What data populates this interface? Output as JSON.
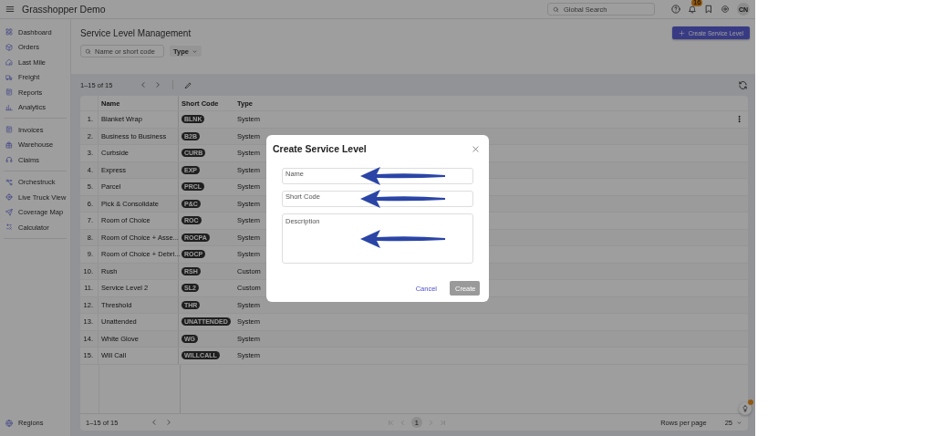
{
  "header": {
    "title": "Grasshopper Demo",
    "search_placeholder": "Global Search",
    "notification_count": "16",
    "avatar": "CN"
  },
  "sidebar": {
    "groups": [
      [
        {
          "label": "Dashboard",
          "selected": false
        },
        {
          "label": "Orders",
          "selected": false
        },
        {
          "label": "Last Mile",
          "selected": false
        },
        {
          "label": "Freight",
          "selected": false
        },
        {
          "label": "Reports",
          "selected": false
        },
        {
          "label": "Analytics",
          "selected": false
        }
      ],
      [
        {
          "label": "Invoices",
          "selected": false
        },
        {
          "label": "Warehouse",
          "selected": false
        },
        {
          "label": "Claims",
          "selected": false
        }
      ],
      [
        {
          "label": "Orchestruck",
          "selected": false
        },
        {
          "label": "Live Truck View",
          "selected": false
        },
        {
          "label": "Coverage Map",
          "selected": false
        },
        {
          "label": "Calculator",
          "selected": false
        }
      ]
    ],
    "bottom_item": {
      "label": "Regions",
      "selected": false
    }
  },
  "page": {
    "title": "Service Level Management",
    "search_placeholder": "Name or short code",
    "filter": "Type",
    "create_button": "Create Service Level",
    "range": "1–15 of 15"
  },
  "table": {
    "columns": [
      "Name",
      "Short Code",
      "Type"
    ],
    "rows": [
      {
        "index": "1.",
        "name": "Blanket Wrap",
        "code": "BLNK",
        "type": "System"
      },
      {
        "index": "2.",
        "name": "Business to Business",
        "code": "B2B",
        "type": "System"
      },
      {
        "index": "3.",
        "name": "Curbside",
        "code": "CURB",
        "type": "System"
      },
      {
        "index": "4.",
        "name": "Express",
        "code": "EXP",
        "type": "System"
      },
      {
        "index": "5.",
        "name": "Parcel",
        "code": "PRCL",
        "type": "System"
      },
      {
        "index": "6.",
        "name": "Pick & Consolidate",
        "code": "P&C",
        "type": "System"
      },
      {
        "index": "7.",
        "name": "Room of Choice",
        "code": "ROC",
        "type": "System"
      },
      {
        "index": "8.",
        "name": "Room of Choice + Asse...",
        "code": "ROCPA",
        "type": "System"
      },
      {
        "index": "9.",
        "name": "Room of Choice + Debri...",
        "code": "ROCP",
        "type": "System"
      },
      {
        "index": "10.",
        "name": "Rush",
        "code": "RSH",
        "type": "Custom"
      },
      {
        "index": "11.",
        "name": "Service Level 2",
        "code": "SL2",
        "type": "Custom"
      },
      {
        "index": "12.",
        "name": "Threshold",
        "code": "THR",
        "type": "System"
      },
      {
        "index": "13.",
        "name": "Unattended",
        "code": "UNATTENDED",
        "type": "System"
      },
      {
        "index": "14.",
        "name": "White Glove",
        "code": "WG",
        "type": "System"
      },
      {
        "index": "15.",
        "name": "Will Call",
        "code": "WILLCALL",
        "type": "System"
      }
    ]
  },
  "footer": {
    "range": "1–15 of 15",
    "page": "1",
    "rows_per_page_label": "Rows per page",
    "rows_per_page": "25"
  },
  "modal": {
    "title": "Create Service Level",
    "fields": [
      {
        "kind": "input",
        "placeholder": "Name"
      },
      {
        "kind": "input",
        "placeholder": "Short Code"
      },
      {
        "kind": "textarea",
        "placeholder": "Description"
      }
    ],
    "cancel": "Cancel",
    "create": {
      "label": "Create",
      "disabled": true
    }
  }
}
